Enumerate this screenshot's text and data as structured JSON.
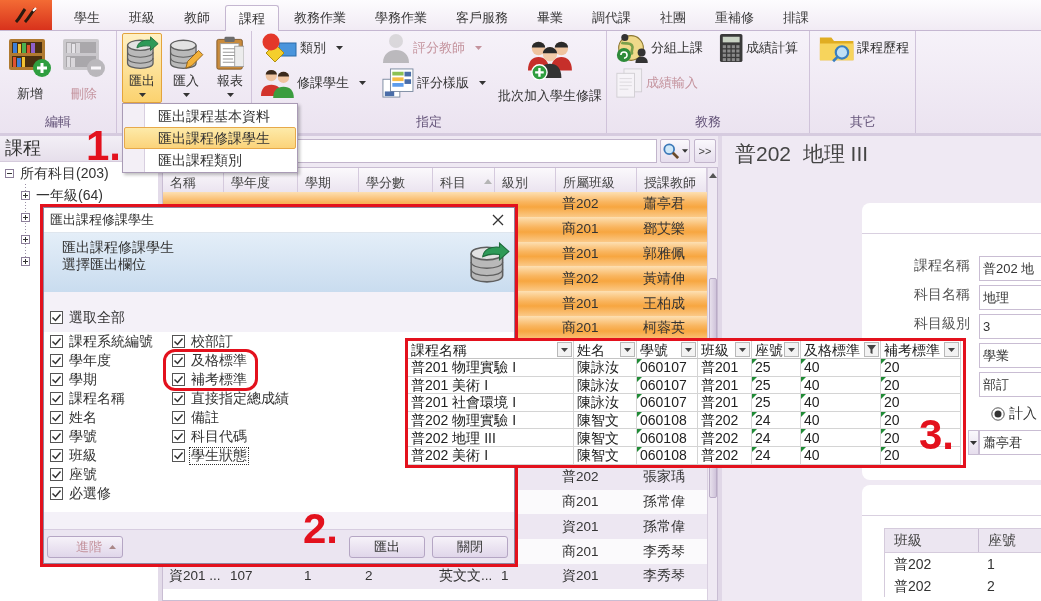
{
  "tabs": [
    {
      "label": "學生",
      "selected": false
    },
    {
      "label": "班級",
      "selected": false
    },
    {
      "label": "教師",
      "selected": false
    },
    {
      "label": "課程",
      "selected": true
    },
    {
      "label": "教務作業",
      "selected": false
    },
    {
      "label": "學務作業",
      "selected": false
    },
    {
      "label": "客戶服務",
      "selected": false
    },
    {
      "label": "畢業",
      "selected": false
    },
    {
      "label": "調代課",
      "selected": false
    },
    {
      "label": "社團",
      "selected": false
    },
    {
      "label": "重補修",
      "selected": false
    },
    {
      "label": "排課",
      "selected": false
    }
  ],
  "ribbon": {
    "groups": [
      {
        "label": "編輯",
        "buttons": [
          {
            "label": "新增",
            "kind": "large",
            "menu": false,
            "pressed": false,
            "disabled": false
          },
          {
            "label": "刪除",
            "kind": "large",
            "menu": false,
            "pressed": false,
            "disabled": true
          }
        ]
      },
      {
        "buttons": [
          {
            "label": "匯出",
            "kind": "large",
            "menu": true,
            "pressed": true,
            "disabled": false
          },
          {
            "label": "匯入",
            "kind": "large",
            "menu": true,
            "pressed": false,
            "disabled": false
          },
          {
            "label": "報表",
            "kind": "large",
            "menu": true,
            "pressed": false,
            "disabled": false
          }
        ]
      },
      {
        "label": "指定",
        "buttons": [
          {
            "label": "類別",
            "kind": "small",
            "menu": true,
            "pressed": false,
            "disabled": false
          },
          {
            "label": "評分教師",
            "kind": "small",
            "menu": true,
            "pressed": false,
            "disabled": true
          },
          {
            "label": "修課學生",
            "kind": "small",
            "menu": true,
            "pressed": false,
            "disabled": false
          },
          {
            "label": "評分樣版",
            "kind": "small",
            "menu": true,
            "pressed": false,
            "disabled": false
          },
          {
            "label": "批次加入學生修課",
            "kind": "large",
            "menu": false,
            "pressed": false,
            "disabled": false
          }
        ]
      },
      {
        "label": "教務",
        "buttons": [
          {
            "label": "分組上課",
            "kind": "small",
            "menu": false,
            "pressed": false,
            "disabled": false
          },
          {
            "label": "成績計算",
            "kind": "small",
            "menu": false,
            "pressed": false,
            "disabled": false
          },
          {
            "label": "成績輸入",
            "kind": "small",
            "menu": false,
            "pressed": false,
            "disabled": true
          }
        ]
      },
      {
        "label": "其它",
        "buttons": [
          {
            "label": "課程歷程",
            "kind": "small",
            "menu": false,
            "pressed": false,
            "disabled": false
          }
        ]
      }
    ]
  },
  "export_menu": {
    "items": [
      {
        "label": "匯出課程基本資料",
        "selected": false
      },
      {
        "label": "匯出課程修課學生",
        "selected": true
      },
      {
        "label": "匯出課程類別",
        "selected": false
      }
    ]
  },
  "course_panel": {
    "title": "課程",
    "tree": {
      "label": "所有科目(203)",
      "expanded": true,
      "children": [
        {
          "label": "一年級(64)",
          "expanded": false
        },
        {
          "expanded": false
        },
        {
          "expanded": false
        },
        {
          "expanded": false
        }
      ]
    }
  },
  "course_list": {
    "expand_button": ">>",
    "columns": [
      {
        "label": "名稱",
        "sorted": false
      },
      {
        "label": "學年度",
        "sorted": false
      },
      {
        "label": "學期",
        "sorted": false
      },
      {
        "label": "學分數",
        "sorted": false
      },
      {
        "label": "科目",
        "sorted": true
      },
      {
        "label": "級別",
        "sorted": false
      },
      {
        "label": "所屬班級",
        "sorted": false
      },
      {
        "label": "授課教師",
        "sorted": false
      }
    ],
    "rows": [
      {
        "selected": true,
        "class": "普202",
        "teacher": "蕭亭君"
      },
      {
        "selected": true,
        "class": "商201",
        "teacher": "鄧艾樂"
      },
      {
        "selected": true,
        "class": "普201",
        "teacher": "郭雅佩"
      },
      {
        "selected": true,
        "class": "普202",
        "teacher": "黃靖伸"
      },
      {
        "selected": true,
        "class": "普201",
        "teacher": "王柏成"
      },
      {
        "selected": true,
        "class": "商201",
        "teacher": "柯蓉英"
      },
      {
        "selected": false,
        "class": "普202",
        "teacher": "張家瑀"
      },
      {
        "selected": false,
        "class": "商201",
        "teacher": "孫常偉"
      },
      {
        "selected": false,
        "class": "資201",
        "teacher": "孫常偉"
      },
      {
        "selected": false,
        "class": "商201",
        "teacher": "李秀琴"
      },
      {
        "selected": false,
        "name": "資201 ...",
        "year": "107",
        "term": "1",
        "credits": "2",
        "subject": "英文文...",
        "level": "1",
        "class": "資201",
        "teacher": "李秀琴"
      }
    ]
  },
  "detail": {
    "title": "普202  地理 III",
    "form": [
      {
        "kind": "text",
        "label": "課程名稱",
        "value": "普202 地"
      },
      {
        "kind": "text",
        "label": "科目名稱",
        "value": "地理"
      },
      {
        "kind": "text",
        "label": "科目級別",
        "value": "3"
      },
      {
        "kind": "text",
        "value": "學業"
      },
      {
        "kind": "text",
        "value": "部訂"
      },
      {
        "kind": "radio",
        "options": [
          {
            "label": "計入",
            "selected": true
          }
        ]
      },
      {
        "kind": "combo",
        "value": "蕭亭君"
      }
    ],
    "students": {
      "columns": [
        "班級",
        "座號"
      ],
      "rows": [
        [
          "普202",
          "1"
        ],
        [
          "普202",
          "2"
        ]
      ]
    }
  },
  "export_dialog": {
    "title": "匯出課程修課學生",
    "heading": "匯出課程修課學生",
    "subheading": "選擇匯出欄位",
    "select_all": {
      "label": "選取全部",
      "checked": true
    },
    "field_columns": [
      [
        {
          "label": "課程系統編號",
          "checked": true,
          "focused": false
        },
        {
          "label": "學年度",
          "checked": true,
          "focused": false
        },
        {
          "label": "學期",
          "checked": true,
          "focused": false
        },
        {
          "label": "課程名稱",
          "checked": true,
          "focused": false
        },
        {
          "label": "姓名",
          "checked": true,
          "focused": false
        },
        {
          "label": "學號",
          "checked": true,
          "focused": false
        },
        {
          "label": "班級",
          "checked": true,
          "focused": false
        },
        {
          "label": "座號",
          "checked": true,
          "focused": false
        },
        {
          "label": "必選修",
          "checked": true,
          "focused": false
        }
      ],
      [
        {
          "label": "校部訂",
          "checked": true,
          "focused": false
        },
        {
          "label": "及格標準",
          "checked": true,
          "focused": false
        },
        {
          "label": "補考標準",
          "checked": true,
          "focused": false
        },
        {
          "label": "直接指定總成績",
          "checked": true,
          "focused": false
        },
        {
          "label": "備註",
          "checked": true,
          "focused": false
        },
        {
          "label": "科目代碼",
          "checked": true,
          "focused": false
        },
        {
          "label": "學生狀態",
          "checked": true,
          "focused": true
        }
      ]
    ],
    "buttons": [
      {
        "label": "進階",
        "menu": true,
        "disabled": true
      },
      {
        "label": "匯出",
        "menu": false,
        "disabled": false
      },
      {
        "label": "關閉",
        "menu": false,
        "disabled": false
      }
    ]
  },
  "export_preview": {
    "columns": [
      {
        "label": "課程名稱",
        "filtered": false,
        "error_marks": false
      },
      {
        "label": "姓名",
        "filtered": false,
        "error_marks": false
      },
      {
        "label": "學號",
        "filtered": false,
        "error_marks": true
      },
      {
        "label": "班級",
        "filtered": false,
        "error_marks": false
      },
      {
        "label": "座號",
        "filtered": false,
        "error_marks": true
      },
      {
        "label": "及格標準",
        "filtered": true,
        "error_marks": true
      },
      {
        "label": "補考標準",
        "filtered": false,
        "error_marks": true
      }
    ],
    "rows": [
      [
        "普201 物理實驗 I",
        "陳詠汝",
        "060107",
        "普201",
        "25",
        "40",
        "20"
      ],
      [
        "普201 美術 I",
        "陳詠汝",
        "060107",
        "普201",
        "25",
        "40",
        "20"
      ],
      [
        "普201 社會環境 I",
        "陳詠汝",
        "060107",
        "普201",
        "25",
        "40",
        "20"
      ],
      [
        "普202 物理實驗 I",
        "陳智文",
        "060108",
        "普202",
        "24",
        "40",
        "20"
      ],
      [
        "普202 地理 III",
        "陳智文",
        "060108",
        "普202",
        "24",
        "40",
        "20"
      ],
      [
        "普202 美術 I",
        "陳智文",
        "060108",
        "普202",
        "24",
        "40",
        "20"
      ]
    ]
  },
  "annotations": [
    {
      "label": "1."
    },
    {
      "label": "2."
    },
    {
      "label": "3."
    }
  ]
}
